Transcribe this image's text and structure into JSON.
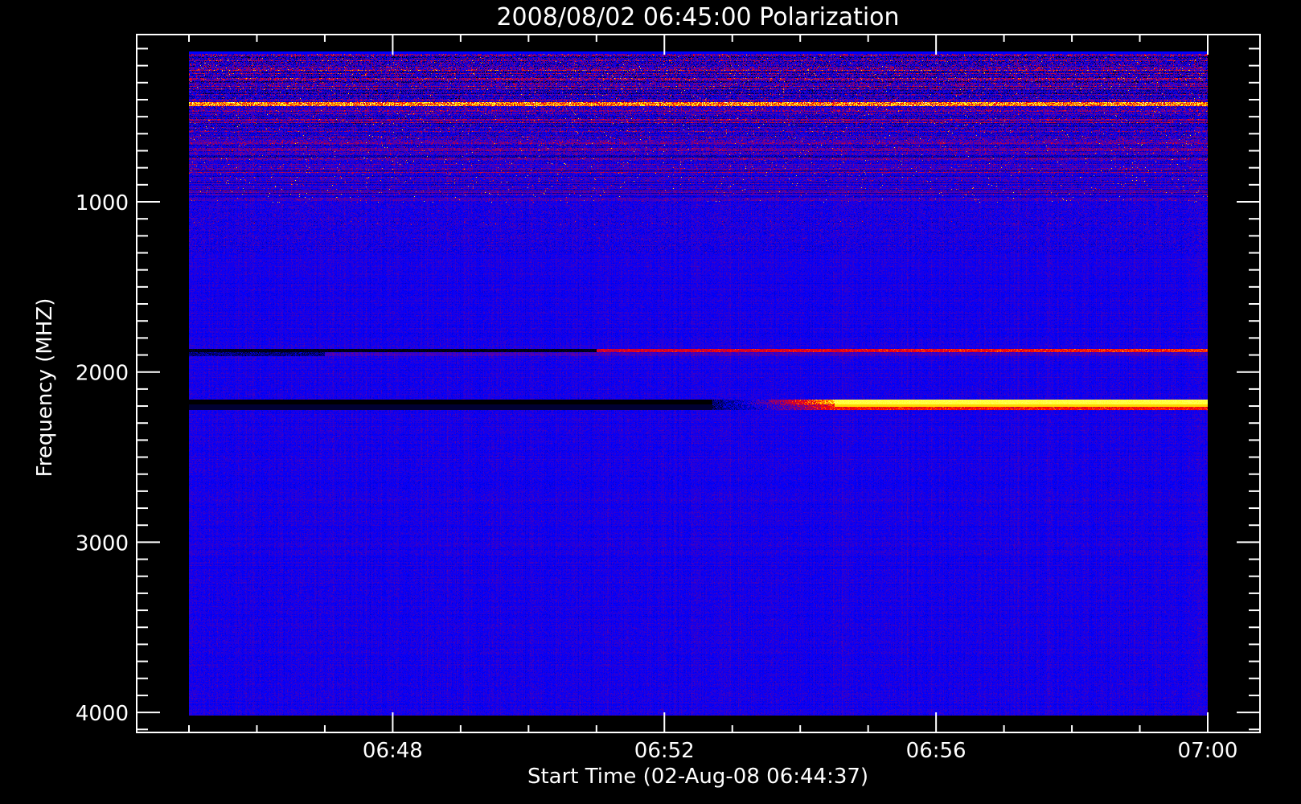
{
  "chart_data": {
    "type": "heatmap",
    "title": "2008/08/02 06:45:00 Polarization",
    "xlabel": "Start Time (02-Aug-08 06:44:37)",
    "ylabel": "Frequency (MHZ)",
    "x_range": [
      "06:45:00",
      "07:00:00"
    ],
    "x_axis_range": [
      "06:44:14",
      "07:00:46"
    ],
    "x_ticks": [
      {
        "time": "06:48",
        "label": "06:48"
      },
      {
        "time": "06:52",
        "label": "06:52"
      },
      {
        "time": "06:56",
        "label": "06:56"
      },
      {
        "time": "07:00",
        "label": "07:00"
      }
    ],
    "x_minor_tick_step_min": 1,
    "y_range_mhz": [
      115,
      4020
    ],
    "y_axis_range_mhz": [
      0,
      4120
    ],
    "y_inverted": true,
    "y_ticks": [
      {
        "value": 1000,
        "label": "1000"
      },
      {
        "value": 2000,
        "label": "2000"
      },
      {
        "value": 3000,
        "label": "3000"
      },
      {
        "value": 4000,
        "label": "4000"
      }
    ],
    "y_minor_tick_step_mhz": 100,
    "colorscale": [
      "#000000",
      "#0000ff",
      "#ff0000",
      "#ffff00",
      "#ffffff"
    ],
    "features": [
      {
        "name": "strong-rfi-line",
        "freq_mhz": 424,
        "start": "06:45",
        "end": "07:00",
        "level": "yellow"
      },
      {
        "name": "intermittent-band",
        "freq_mhz": 1120,
        "start": "06:45",
        "end": "07:00",
        "level": "sporadic"
      },
      {
        "name": "band-1870",
        "freq_mhz": 1870,
        "start": "06:51",
        "end": "07:00",
        "level": "red",
        "before": "black"
      },
      {
        "name": "band-2180",
        "freq_mhz": 2180,
        "start": "06:53",
        "end": "07:00",
        "level": "yellow",
        "before": "black"
      }
    ]
  }
}
